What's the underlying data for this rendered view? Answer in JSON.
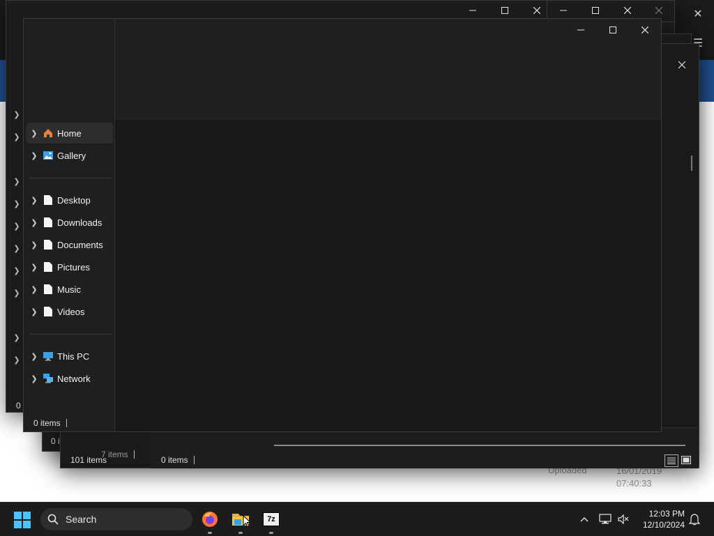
{
  "background": {
    "uploaded_label": "Uploaded",
    "date_line1": "16/01/2019",
    "date_line2": "07:40:33"
  },
  "back_windows": {
    "status_101": "101 items",
    "status_7": "7 items",
    "status_0a": "0 items",
    "status_0b": "0 items",
    "status_0c": "0 i"
  },
  "front_window": {
    "nav": {
      "items": [
        {
          "label": "Home",
          "icon": "home-icon",
          "selected": true
        },
        {
          "label": "Gallery",
          "icon": "gallery-icon"
        },
        {
          "label": "Desktop",
          "icon": "file-icon"
        },
        {
          "label": "Downloads",
          "icon": "file-icon"
        },
        {
          "label": "Documents",
          "icon": "file-icon"
        },
        {
          "label": "Pictures",
          "icon": "file-icon"
        },
        {
          "label": "Music",
          "icon": "file-icon"
        },
        {
          "label": "Videos",
          "icon": "file-icon"
        },
        {
          "label": "This PC",
          "icon": "monitor-icon"
        },
        {
          "label": "Network",
          "icon": "network-icon"
        }
      ]
    },
    "status": "0 items"
  },
  "taskbar": {
    "search_label": "Search",
    "apps": [
      "firefox-icon",
      "file-explorer-icon",
      "7zip-icon"
    ],
    "sevenzip_label": "7z",
    "time": "12:03 PM",
    "date": "12/10/2024"
  },
  "colors": {
    "window_bg": "#1c1c1c",
    "taskbar_bg": "#1c1c1c",
    "accent_blue": "#1f4f8f",
    "folder_yellow": "#f3c34a"
  }
}
